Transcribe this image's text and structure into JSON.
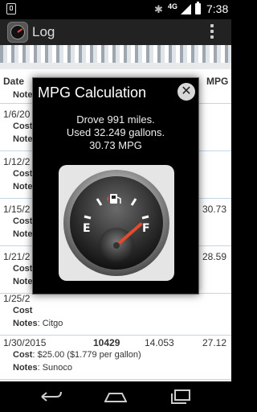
{
  "status": {
    "time": "7:38",
    "network": "4G"
  },
  "actionbar": {
    "title": "Log"
  },
  "table": {
    "headers": {
      "date": "Date",
      "mpg": "MPG"
    },
    "rows": [
      {
        "date": "",
        "odometer": "",
        "gallons": "",
        "mpg": "",
        "cost_label": "",
        "cost": "",
        "notes_label": "Notes",
        "notes": ""
      },
      {
        "date": "1/6/20",
        "odometer": "",
        "gallons": "",
        "mpg": "",
        "cost_label": "Cost",
        "cost": "",
        "notes_label": "Notes",
        "notes": ""
      },
      {
        "date": "1/12/2",
        "odometer": "",
        "gallons": "",
        "mpg": "",
        "cost_label": "Cost",
        "cost": "",
        "notes_label": "Notes",
        "notes": ""
      },
      {
        "date": "1/15/2",
        "odometer": "",
        "gallons": "",
        "mpg": "30.73",
        "cost_label": "Cost",
        "cost": "",
        "notes_label": "Notes",
        "notes": ""
      },
      {
        "date": "1/21/2",
        "odometer": "",
        "gallons": "",
        "mpg": "28.59",
        "cost_label": "Cost",
        "cost": "",
        "notes_label": "Notes",
        "notes": ""
      },
      {
        "date": "1/25/2",
        "odometer": "",
        "gallons": "",
        "mpg": "",
        "cost_label": "Cost",
        "cost": "",
        "notes_label": "Notes",
        "notes": "Citgo"
      },
      {
        "date": "1/30/2015",
        "odometer": "10429",
        "gallons": "14.053",
        "mpg": "27.12",
        "cost_label": "Cost",
        "cost": "$25.00 ($1.779 per gallon)",
        "notes_label": "Notes",
        "notes": "Sunoco"
      }
    ]
  },
  "dialog": {
    "title": "MPG Calculation",
    "line1": "Drove 991 miles.",
    "line2": "Used 32.249 gallons.",
    "line3": "30.73 MPG",
    "gauge": {
      "empty_label": "E",
      "full_label": "F",
      "fuel_level": 0.85,
      "icon": "fuel-pump-icon"
    }
  },
  "colors": {
    "accent": "#e44b2c",
    "divider": "#c7d5e2"
  }
}
